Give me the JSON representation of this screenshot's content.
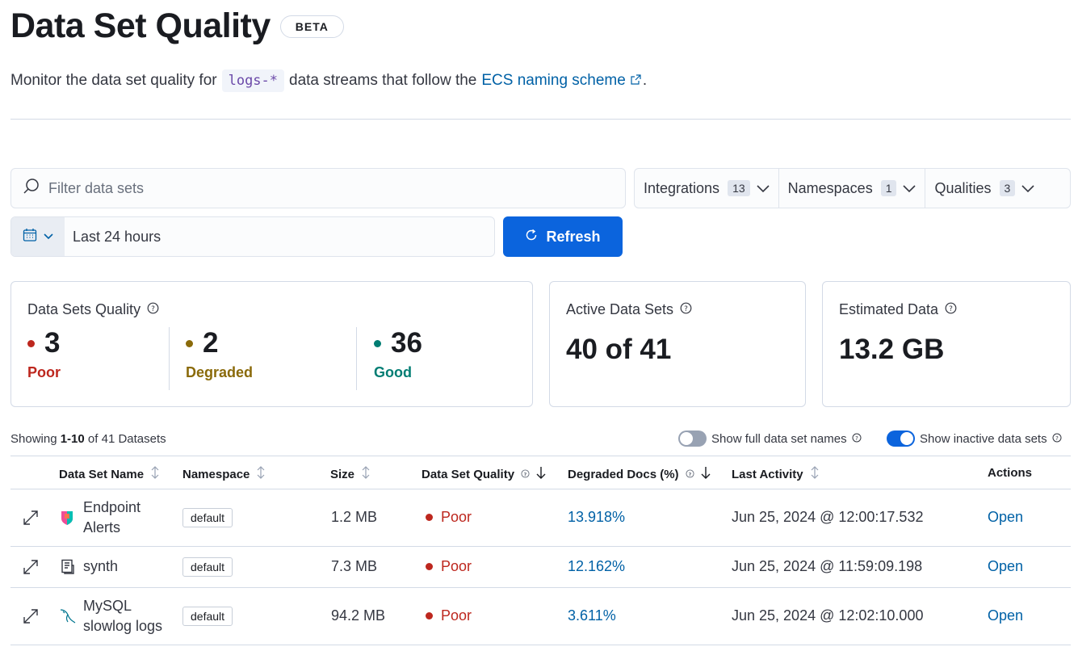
{
  "header": {
    "title": "Data Set Quality",
    "badge": "BETA",
    "description_prefix": "Monitor the data set quality for",
    "code_pattern": "logs-*",
    "description_middle": "data streams that follow the",
    "link_text": "ECS naming scheme",
    "description_suffix": "."
  },
  "filters": {
    "search_placeholder": "Filter data sets",
    "integrations_label": "Integrations",
    "integrations_count": "13",
    "namespaces_label": "Namespaces",
    "namespaces_count": "1",
    "qualities_label": "Qualities",
    "qualities_count": "3",
    "time_range": "Last 24 hours",
    "refresh_label": "Refresh"
  },
  "summary": {
    "quality_title": "Data Sets Quality",
    "poor_count": "3",
    "poor_label": "Poor",
    "degraded_count": "2",
    "degraded_label": "Degraded",
    "good_count": "36",
    "good_label": "Good",
    "active_title": "Active Data Sets",
    "active_value": "40 of 41",
    "estimated_title": "Estimated Data",
    "estimated_value": "13.2 GB"
  },
  "table_controls": {
    "showing_prefix": "Showing",
    "showing_range": "1-10",
    "showing_suffix": "of 41 Datasets",
    "full_names_label": "Show full data set names",
    "inactive_label": "Show inactive data sets"
  },
  "colors": {
    "poor": "#bd271e",
    "degraded": "#8a6a0a",
    "good": "#017d73",
    "primary": "#0b64dd",
    "link": "#0061a6"
  },
  "table": {
    "columns": [
      "Data Set Name",
      "Namespace",
      "Size",
      "Data Set Quality",
      "Degraded Docs (%)",
      "Last Activity",
      "Actions"
    ],
    "rows": [
      {
        "name_line1": "Endpoint",
        "name_line2": "Alerts",
        "icon": "endpoint-security-icon",
        "namespace": "default",
        "size": "1.2 MB",
        "quality": "Poor",
        "degraded_pct": "13.918%",
        "last_activity": "Jun 25, 2024 @ 12:00:17.532",
        "action": "Open"
      },
      {
        "name_line1": "synth",
        "name_line2": "",
        "icon": "document-icon",
        "namespace": "default",
        "size": "7.3 MB",
        "quality": "Poor",
        "degraded_pct": "12.162%",
        "last_activity": "Jun 25, 2024 @ 11:59:09.198",
        "action": "Open"
      },
      {
        "name_line1": "MySQL",
        "name_line2": "slowlog logs",
        "icon": "mysql-dolphin-icon",
        "namespace": "default",
        "size": "94.2 MB",
        "quality": "Poor",
        "degraded_pct": "3.611%",
        "last_activity": "Jun 25, 2024 @ 12:02:10.000",
        "action": "Open"
      }
    ]
  }
}
